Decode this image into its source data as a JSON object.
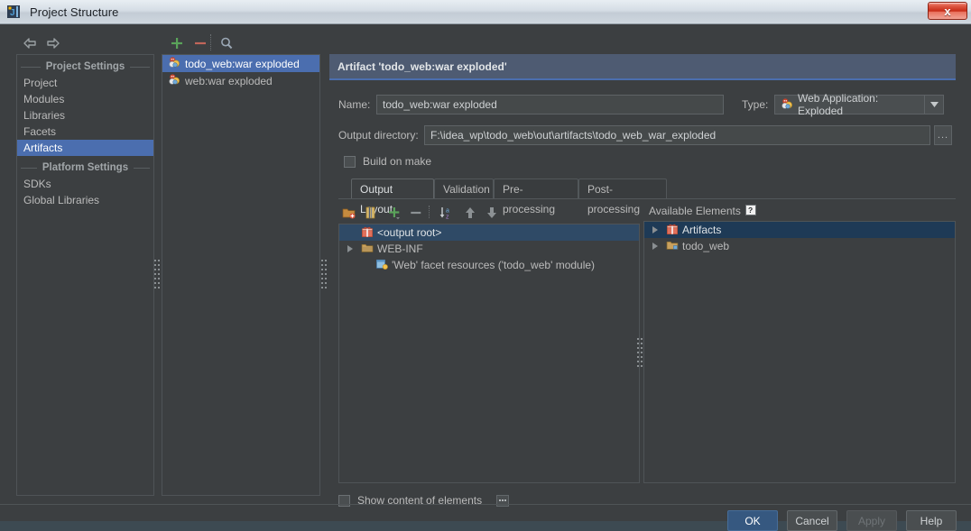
{
  "window": {
    "title": "Project Structure",
    "logo_icon": "intellij-idea-logo-icon",
    "close_label": "x"
  },
  "toolbar": {
    "back_icon": "arrow-left-icon",
    "forward_icon": "arrow-right-icon",
    "add_icon": "plus-icon",
    "remove_icon": "minus-icon",
    "find_icon": "search-icon"
  },
  "sidebar": {
    "groups": [
      {
        "title": "Project Settings",
        "items": [
          {
            "label": "Project",
            "selected": false
          },
          {
            "label": "Modules",
            "selected": false
          },
          {
            "label": "Libraries",
            "selected": false
          },
          {
            "label": "Facets",
            "selected": false
          },
          {
            "label": "Artifacts",
            "selected": true
          }
        ]
      },
      {
        "title": "Platform Settings",
        "items": [
          {
            "label": "SDKs",
            "selected": false
          },
          {
            "label": "Global Libraries",
            "selected": false
          }
        ]
      }
    ]
  },
  "artifact_list": {
    "items": [
      {
        "label": "todo_web:war exploded",
        "icon": "web-artifact-icon",
        "selected": true
      },
      {
        "label": "web:war exploded",
        "icon": "web-artifact-icon",
        "selected": false
      }
    ]
  },
  "detail": {
    "header": "Artifact 'todo_web:war exploded'",
    "name_label": "Name:",
    "name_value": "todo_web:war exploded",
    "type_label": "Type:",
    "type_value": "Web Application: Exploded",
    "type_icon": "web-artifact-icon",
    "type_arrow_icon": "chevron-down-icon",
    "output_dir_label": "Output directory:",
    "output_dir_value": "F:\\idea_wp\\todo_web\\out\\artifacts\\todo_web_war_exploded",
    "browse_label": "...",
    "build_on_make_label": "Build on make",
    "build_on_make_checked": false
  },
  "tabs": [
    {
      "label": "Output Layout",
      "active": true
    },
    {
      "label": "Validation",
      "active": false
    },
    {
      "label": "Pre-processing",
      "active": false
    },
    {
      "label": "Post-processing",
      "active": false
    }
  ],
  "layout_toolbar": {
    "create_dir_icon": "create-directory-icon",
    "create_archive_icon": "create-archive-icon",
    "add_copy_icon": "add-copy-of-icon",
    "remove_icon": "minus-icon",
    "sort_icon": "sort-az-icon",
    "move_up_icon": "arrow-up-icon",
    "move_down_icon": "arrow-down-icon"
  },
  "output_tree": {
    "nodes": [
      {
        "label": "<output root>",
        "icon": "artifact-package-icon",
        "expandable": false,
        "indent": 0,
        "selected": true
      },
      {
        "label": "WEB-INF",
        "icon": "folder-icon",
        "expandable": true,
        "indent": 0,
        "selected": false
      },
      {
        "label": "'Web' facet resources ('todo_web' module)",
        "icon": "web-facet-icon",
        "expandable": false,
        "indent": 1,
        "selected": false
      }
    ]
  },
  "available_elements": {
    "title": "Available Elements",
    "help_icon": "help-question-icon",
    "nodes": [
      {
        "label": "Artifacts",
        "icon": "artifact-package-icon",
        "expandable": true,
        "selected": true
      },
      {
        "label": "todo_web",
        "icon": "module-folder-icon",
        "expandable": true,
        "selected": false
      }
    ]
  },
  "show_content": {
    "label": "Show content of elements",
    "checked": false,
    "options_icon": "ellipsis-icon"
  },
  "footer": {
    "ok": "OK",
    "cancel": "Cancel",
    "apply": "Apply",
    "help": "Help"
  }
}
